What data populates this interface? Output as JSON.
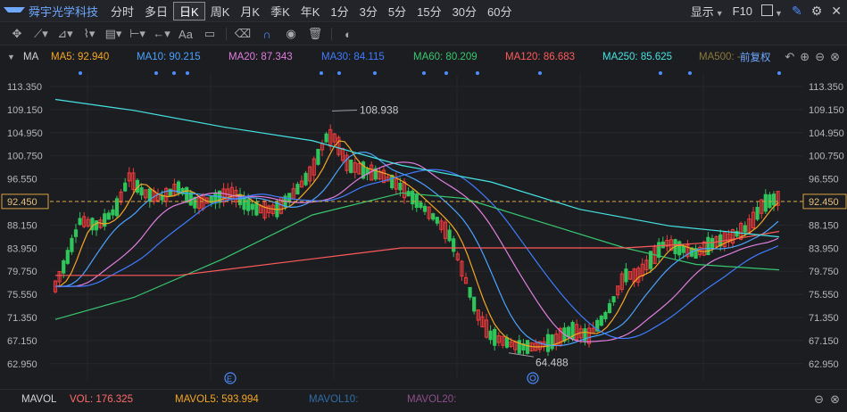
{
  "topbar": {
    "stock_name": "舜宇光学科技",
    "periods": [
      "分时",
      "多日",
      "日K",
      "周K",
      "月K",
      "季K",
      "年K",
      "1分",
      "3分",
      "5分",
      "15分",
      "30分",
      "60分"
    ],
    "active_period": "日K",
    "show_label": "显示",
    "f10_label": "F10"
  },
  "ma_legend": {
    "name": "MA",
    "items": [
      {
        "label": "MA5: 92.940",
        "color": "#f5a623"
      },
      {
        "label": "MA10: 90.215",
        "color": "#4aa3ff"
      },
      {
        "label": "MA20: 87.343",
        "color": "#e07ee0"
      },
      {
        "label": "MA30: 84.115",
        "color": "#3e7cff"
      },
      {
        "label": "MA60: 80.209",
        "color": "#38c76f"
      },
      {
        "label": "MA120: 86.683",
        "color": "#ff5a5a"
      },
      {
        "label": "MA250: 85.625",
        "color": "#46e3e3"
      },
      {
        "label": "MA500: --",
        "color": "#8a7a3a"
      }
    ],
    "adjust_label": "前复权"
  },
  "price_axis": {
    "labels": [
      "113.350",
      "109.150",
      "104.950",
      "100.750",
      "96.550",
      "92.450",
      "88.150",
      "83.950",
      "79.750",
      "75.550",
      "71.350",
      "67.150",
      "62.950"
    ],
    "current_price": "92.450"
  },
  "annotations": {
    "high_label": "108.938",
    "low_label": "64.488"
  },
  "volume_legend": {
    "name": "MAVOL",
    "items": [
      {
        "label": "VOL: 176.325",
        "color": "#ff6b6b"
      },
      {
        "label": "MAVOL5: 593.994",
        "color": "#f5a623"
      },
      {
        "label": "MAVOL10:",
        "color": "#2f6ea8"
      },
      {
        "label": "MAVOL20:",
        "color": "#8e4f8e"
      }
    ]
  },
  "colors": {
    "up": "#f03c3c",
    "down": "#2fc55b",
    "accent": "#4e8dff",
    "background": "#1c1d21"
  }
}
